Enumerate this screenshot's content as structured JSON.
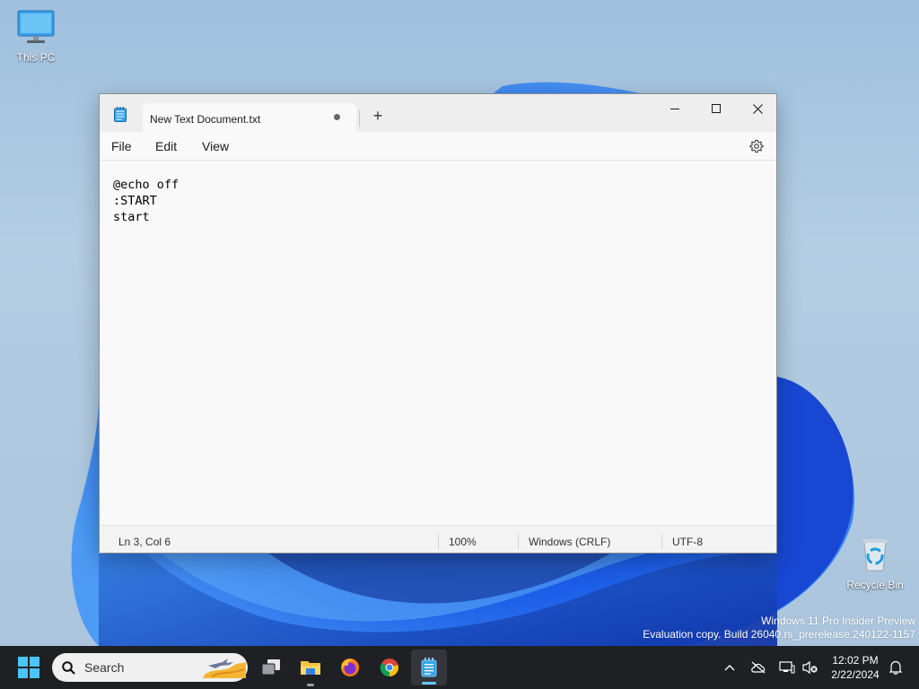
{
  "desktop": {
    "icons": [
      {
        "label": "This PC",
        "icon": "monitor-icon"
      },
      {
        "label": "Recycle Bin",
        "icon": "recycle-bin-icon"
      }
    ],
    "watermark": {
      "line1": "Windows 11 Pro Insider Preview",
      "line2": "Evaluation copy. Build 26040.rs_prerelease.240122-1157"
    }
  },
  "notepad": {
    "tab_title": "New Text Document.txt",
    "unsaved_indicator": "•",
    "new_tab_label": "+",
    "menu": {
      "file": "File",
      "edit": "Edit",
      "view": "View"
    },
    "content_lines": [
      "@echo off",
      ":START",
      "start"
    ],
    "status": {
      "position": "Ln 3, Col 6",
      "zoom": "100%",
      "line_ending": "Windows (CRLF)",
      "encoding": "UTF-8"
    }
  },
  "taskbar": {
    "search_placeholder": "Search",
    "apps": [
      "start-icon",
      "task-view-icon",
      "file-explorer-icon",
      "firefox-icon",
      "chrome-icon",
      "notepad-icon"
    ],
    "clock": {
      "time": "12:02 PM",
      "date": "2/22/2024"
    }
  },
  "colors": {
    "accent": "#0067c0",
    "taskbar": "#1f2023",
    "window_bg": "#f9f9f9"
  }
}
